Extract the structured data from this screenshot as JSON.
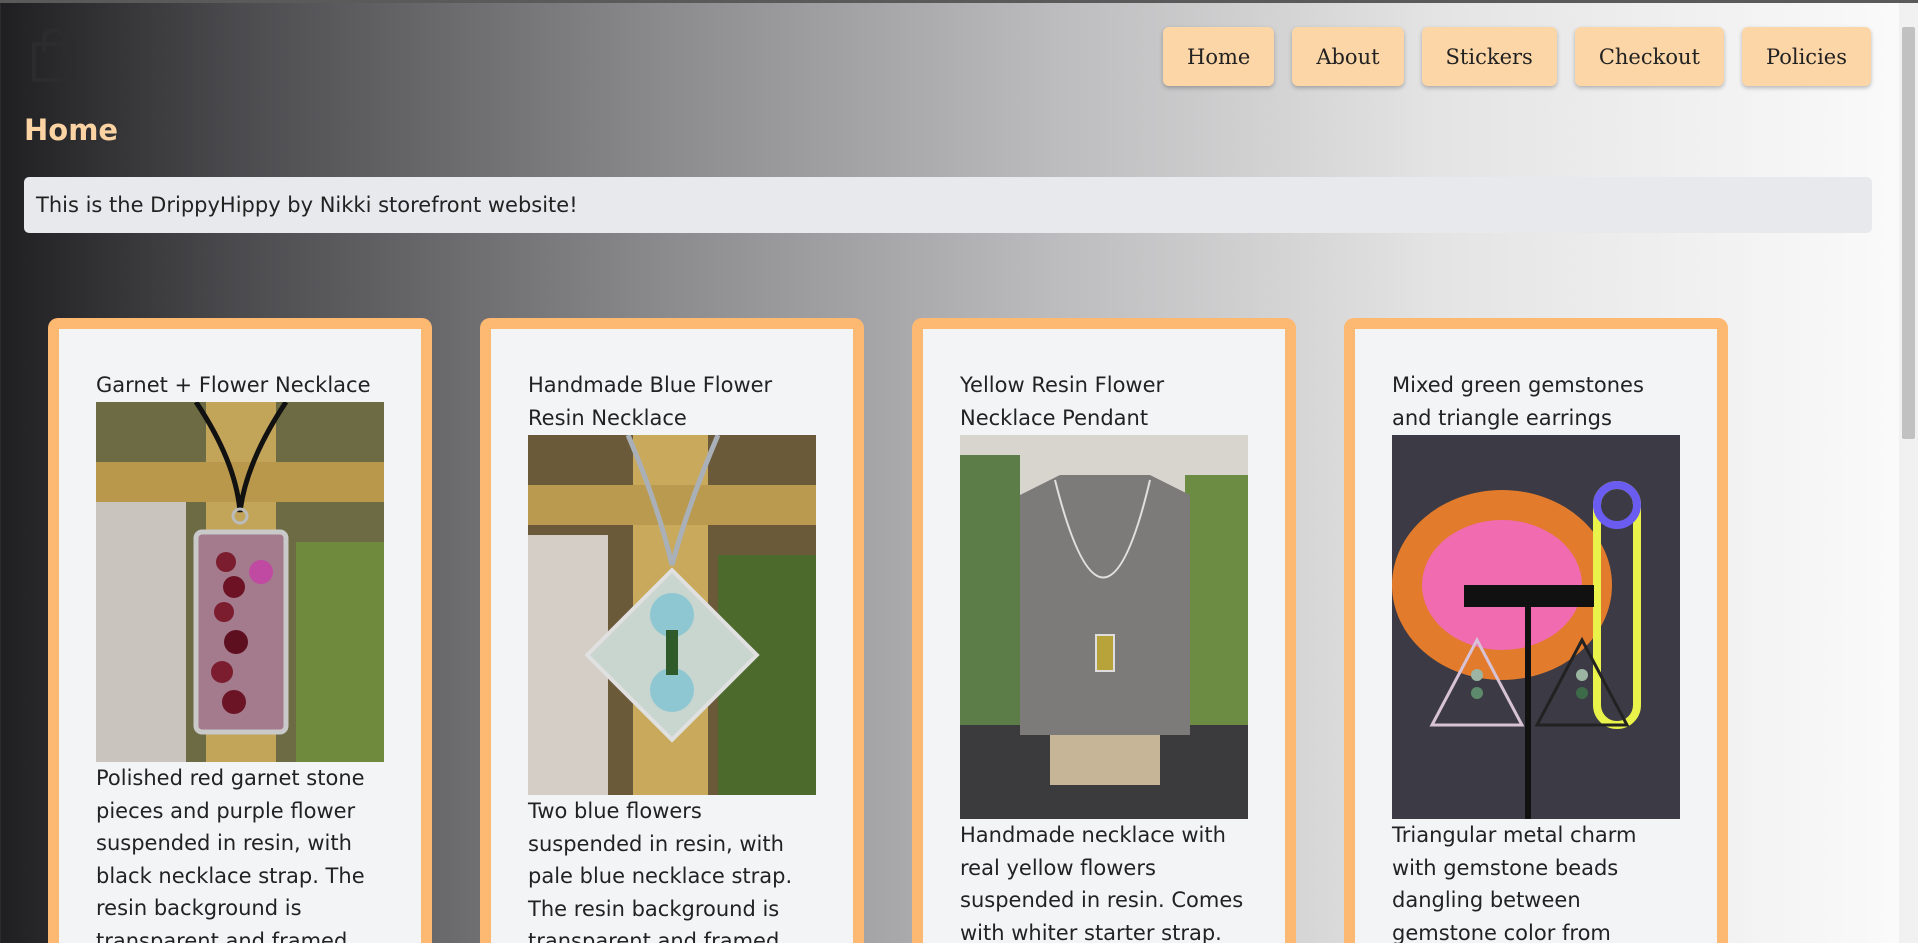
{
  "header": {
    "logo_icon": "shopping-bag-icon"
  },
  "nav": {
    "items": [
      {
        "label": "Home"
      },
      {
        "label": "About"
      },
      {
        "label": "Stickers"
      },
      {
        "label": "Checkout"
      },
      {
        "label": "Policies"
      }
    ]
  },
  "page": {
    "title": "Home",
    "intro": "This is the DrippyHippy by Nikki storefront website!"
  },
  "products": [
    {
      "title": "Garnet + Flower Necklace",
      "description": "Polished red garnet stone pieces and purple flower suspended in resin, with black necklace strap. The resin background is transparent and framed with"
    },
    {
      "title": "Handmade Blue Flower Resin Necklace",
      "description": "Two blue flowers suspended in resin, with pale blue necklace strap. The resin background is transparent and framed with a silver"
    },
    {
      "title": "Yellow Resin Flower Necklace Pendant",
      "description": "Handmade necklace with real yellow flowers suspended in resin. Comes with whiter starter strap."
    },
    {
      "title": "Mixed green gemstones and triangle earrings",
      "description": "Triangular metal charm with gemstone beads dangling between gemstone color from bottom to top:"
    }
  ],
  "colors": {
    "nav_button": "#fdd6a7",
    "card_border": "#fdb872",
    "title": "#fcd3a3"
  }
}
